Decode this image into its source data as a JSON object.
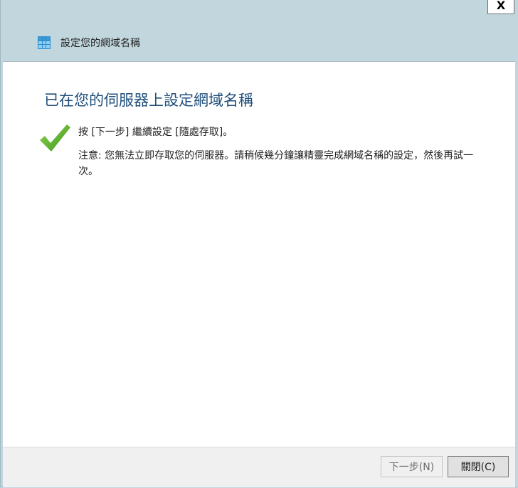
{
  "window": {
    "title": "設定您的網域名稱",
    "close_glyph": "X"
  },
  "main": {
    "heading": "已在您的伺服器上設定網域名稱",
    "instruction": "按 [下一步] 繼續設定 [隨處存取]。",
    "note": "注意: 您無法立即存取您的伺服器。請稍候幾分鐘讓精靈完成網域名稱的設定，然後再試一次。",
    "status_icon": "checkmark-icon",
    "status_color": "#5cb22e"
  },
  "footer": {
    "next_label": "下一步(N)",
    "close_label": "關閉(C)"
  }
}
